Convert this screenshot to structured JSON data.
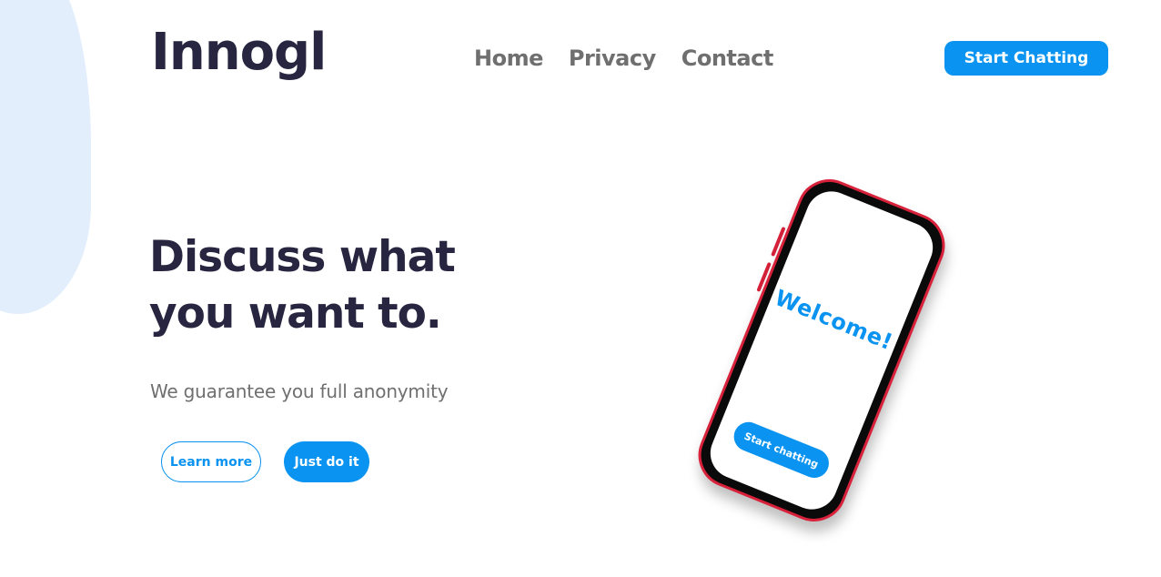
{
  "brand": {
    "logo_text": "Innogl"
  },
  "nav": {
    "items": [
      {
        "label": "Home"
      },
      {
        "label": "Privacy"
      },
      {
        "label": "Contact"
      }
    ],
    "cta_label": "Start Chatting"
  },
  "hero": {
    "headline_line1": "Discuss what",
    "headline_line2": "you want to.",
    "subtitle": "We guarantee you full anonymity",
    "learn_more_label": "Learn more",
    "just_do_it_label": "Just do it"
  },
  "phone": {
    "welcome_text": "Welcome!",
    "button_label": "Start chatting"
  },
  "colors": {
    "accent": "#0a93f0",
    "heading": "#27253f",
    "muted_text": "#6f6f6f",
    "blob": "#e3eefc",
    "phone_frame": "#d8213a"
  }
}
